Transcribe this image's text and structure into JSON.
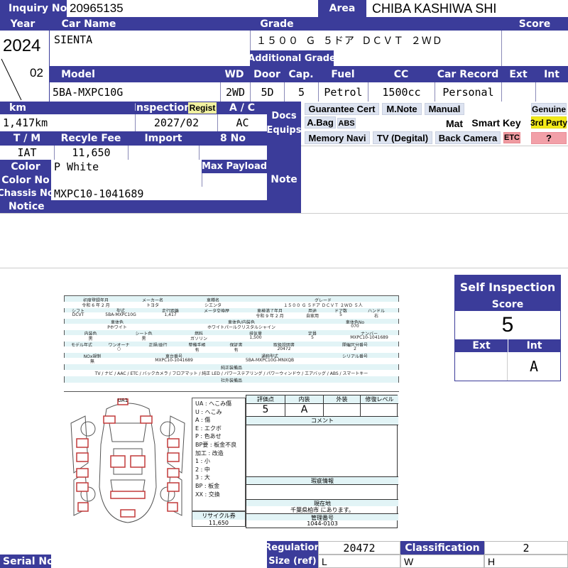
{
  "top": {
    "inquiry_label": "Inquiry No",
    "inquiry_no": "20965135",
    "area_label": "Area",
    "area": "CHIBA KASHIWA SHI"
  },
  "header_row": {
    "year_label": "Year",
    "car_name_label": "Car Name",
    "grade_label": "Grade",
    "score_label": "Score"
  },
  "vehicle": {
    "year": "2024",
    "month": "02",
    "car_name": "SIENTA",
    "grade": "１５００ Ｇ ５ドア ＤＣＶＴ ２ＷＤ",
    "additional_grade_label": "Additional Grade",
    "model": "5BA-MXPC10G",
    "drive": "2WD",
    "door": "5D",
    "capacity": "5",
    "fuel": "Petrol",
    "cc": "1500cc",
    "car_record": "Personal",
    "ext": "",
    "int": ""
  },
  "model_row": {
    "model_label": "Model",
    "wd_label": "WD",
    "door_label": "Door",
    "cap_label": "Cap.",
    "fuel_label": "Fuel",
    "cc_label": "CC",
    "car_record_label": "Car Record",
    "ext_label": "Ext",
    "int_label": "Int"
  },
  "details": {
    "km_label": "km",
    "km": "1,417km",
    "inspection_label": "Inspection",
    "regist_badge": "Regist",
    "inspection": "2027/02",
    "ac_label": "A / C",
    "ac": "AC",
    "tm_label": "T / M",
    "tm": "IAT",
    "recycle_label": "Recyle Fee",
    "recycle": "11,650",
    "import_label": "Import",
    "eight_no_label": "8 No",
    "color_label": "Color",
    "color": "P White",
    "max_payload_label": "Max Payload",
    "color_no_label": "Color No",
    "color_no": "",
    "chassis_label": "Chassis No",
    "chassis_no": "MXPC10-1041689",
    "notice_label": "Notice",
    "docs_label": "Docs",
    "equips_label": "Equips",
    "note_label": "Note"
  },
  "equipment": {
    "guarantee": "Guarantee Cert",
    "mnote": "M.Note",
    "manual": "Manual",
    "genuine": "Genuine",
    "abag": "A.Bag",
    "abs": "ABS",
    "mat": "Mat",
    "smart_key": "Smart Key",
    "third_party": "3rd Party",
    "memory_navi": "Memory Navi",
    "tv": "TV (Degital)",
    "back_camera": "Back Camera",
    "etc": "ETC",
    "question": "?"
  },
  "self_inspection": {
    "title": "Self Inspection",
    "score_label": "Score",
    "score": "5",
    "ext_label": "Ext",
    "int_label": "Int",
    "ext": "",
    "int": "A"
  },
  "sheet": {
    "row1_headers": [
      "初度登録年月",
      "メーカー名",
      "車種名",
      "グレード"
    ],
    "row1_values": [
      "令和 6 年 2 月",
      "トヨタ",
      "シエンタ",
      "１５００ Ｇ ５ドア ＤＣＶＴ ２ＷＤ ５人"
    ],
    "row2_headers": [
      "シフト",
      "型式",
      "走行距離",
      "メータ交換歴",
      "車検満了年月",
      "用途",
      "ドア数",
      "ハンドル"
    ],
    "row2_values": [
      "DCVT",
      "5BA-MXPC10G",
      "1,417",
      "",
      "令和 9 年 2 月",
      "自家用",
      "5",
      "右"
    ],
    "row3_headers": [
      "車体色",
      "車体色/内装色",
      "車体色No"
    ],
    "row3_values": [
      "Pホワイト",
      "ホワイトパールクリスタルシャイン",
      "070"
    ],
    "row4_headers": [
      "内装色",
      "シート色",
      "燃料",
      "排気量",
      "定員",
      "ナンバー"
    ],
    "row4_values": [
      "黒",
      "黒",
      "ガソリン",
      "1,500",
      "5",
      "MXPC10-1041689"
    ],
    "row5_headers": [
      "モデル年式",
      "ワンオーナ",
      "正規/並行",
      "整備手帳",
      "保証書",
      "取扱説明書",
      "開催区分番号"
    ],
    "row5_values": [
      "",
      "○",
      "",
      "有",
      "有",
      "20472",
      "2"
    ],
    "row6_headers": [
      "NOx規制",
      "車台番号",
      "通称型式",
      "シリアル番号"
    ],
    "row6_values": [
      "無",
      "MXPC10-1041689",
      "5BA-MXPC10G-MNXQB",
      ""
    ],
    "equip_header": "純正装備品",
    "equip_values": "TV / ナビ / AAC / ETC / バックカメラ / フロアマット / 純正 LED / パワーステアリング / パワーウィンドウ / エアバッグ / ABS / スマートキー",
    "other_header": "社外装備品",
    "mark_ua1": "UA1",
    "legend": [
      "UA : へこみ傷",
      "U : へこみ",
      "A : 傷",
      "E : エクボ",
      "P : 色あせ",
      "BP要 : 板金不良",
      "加工 : 改造",
      "1 : 小",
      "2 : 中",
      "3 : 大",
      "BP : 板金",
      "XX : 交換"
    ],
    "recycle_label": "リサイクル券",
    "recycle_value": "11,650",
    "score_headers": [
      "評価点",
      "内装",
      "外装",
      "修復レベル"
    ],
    "score_values": [
      "5",
      "A",
      "",
      ""
    ],
    "comment_label": "コメント",
    "defect_label": "瑕疵情報",
    "location_label": "現在地",
    "location_value": "千葉県柏市 にあります。",
    "mgmt_label": "管理番号",
    "mgmt_value": "1044-0103"
  },
  "footer": {
    "regulation_label": "Regulation",
    "regulation": "20472",
    "classification_label": "Classification",
    "classification": "2",
    "serial_label": "Serial No",
    "serial": "",
    "size_label": "Size (ref)",
    "size_l": "L",
    "size_w": "W",
    "size_h": "H"
  },
  "colors": {
    "header_blue": "#3b3c9a",
    "regist_yellow": "#f1f1a0",
    "third_party_yellow": "#f2ea19",
    "etc_red": "#ef9aa0",
    "question_red": "#f2a0a8"
  }
}
